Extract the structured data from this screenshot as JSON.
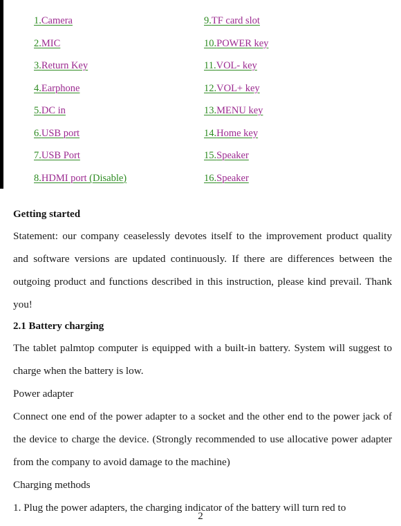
{
  "document": {
    "page_number": "2",
    "accent_colors": {
      "link_text": "#9b2a8f",
      "link_number": "#2e8b22",
      "link_underline": "#2e8b22",
      "body_text": "#1a1a1a"
    }
  },
  "parts_list": {
    "left_column": [
      {
        "number": "1.",
        "name": "Camera",
        "note": ""
      },
      {
        "number": "2.",
        "name": "MIC",
        "note": ""
      },
      {
        "number": "3.",
        "name": "Return Key",
        "note": ""
      },
      {
        "number": "4.",
        "name": "Earphone",
        "note": ""
      },
      {
        "number": "5.",
        "name": "DC in",
        "note": ""
      },
      {
        "number": "6.",
        "name": "USB port",
        "note": ""
      },
      {
        "number": "7.",
        "name": "USB Port",
        "note": ""
      },
      {
        "number": "8.",
        "name": "HDMI port",
        "note": " (Disable)"
      }
    ],
    "right_column": [
      {
        "number": "9.",
        "name": "TF card slot",
        "note": ""
      },
      {
        "number": "10.",
        "name": "POWER key",
        "note": ""
      },
      {
        "number": "11.",
        "name": "VOL- key",
        "note": ""
      },
      {
        "number": "12.",
        "name": "VOL+ key",
        "note": ""
      },
      {
        "number": "13.",
        "name": "MENU key",
        "note": ""
      },
      {
        "number": "14.",
        "name": "Home key",
        "note": ""
      },
      {
        "number": "15.",
        "name": "Speaker",
        "note": ""
      },
      {
        "number": "16.",
        "name": "Speaker",
        "note": ""
      }
    ]
  },
  "content": {
    "heading_getting_started": "Getting started",
    "para_statement": "Statement: our company ceaselessly devotes itself to the improvement product quality and software versions are updated continuously. If there are differences between the outgoing product and functions described in this instruction, please kind prevail. Thank you!",
    "heading_battery_charging": "2.1 Battery charging",
    "para_battery": "The tablet palmtop computer is equipped with a built-in battery. System will suggest to charge when the battery is low.",
    "para_power_adapter_label": "Power adapter",
    "para_connect": "Connect one end of the power adapter to a socket and the other end to the power jack of the device to charge the device. (Strongly recommended to use allocative power adapter from the company to avoid damage to the machine)",
    "para_charging_methods_label": "Charging methods",
    "para_step_one": "1. Plug the power adapters, the charging  indicator of the battery will turn red to"
  }
}
